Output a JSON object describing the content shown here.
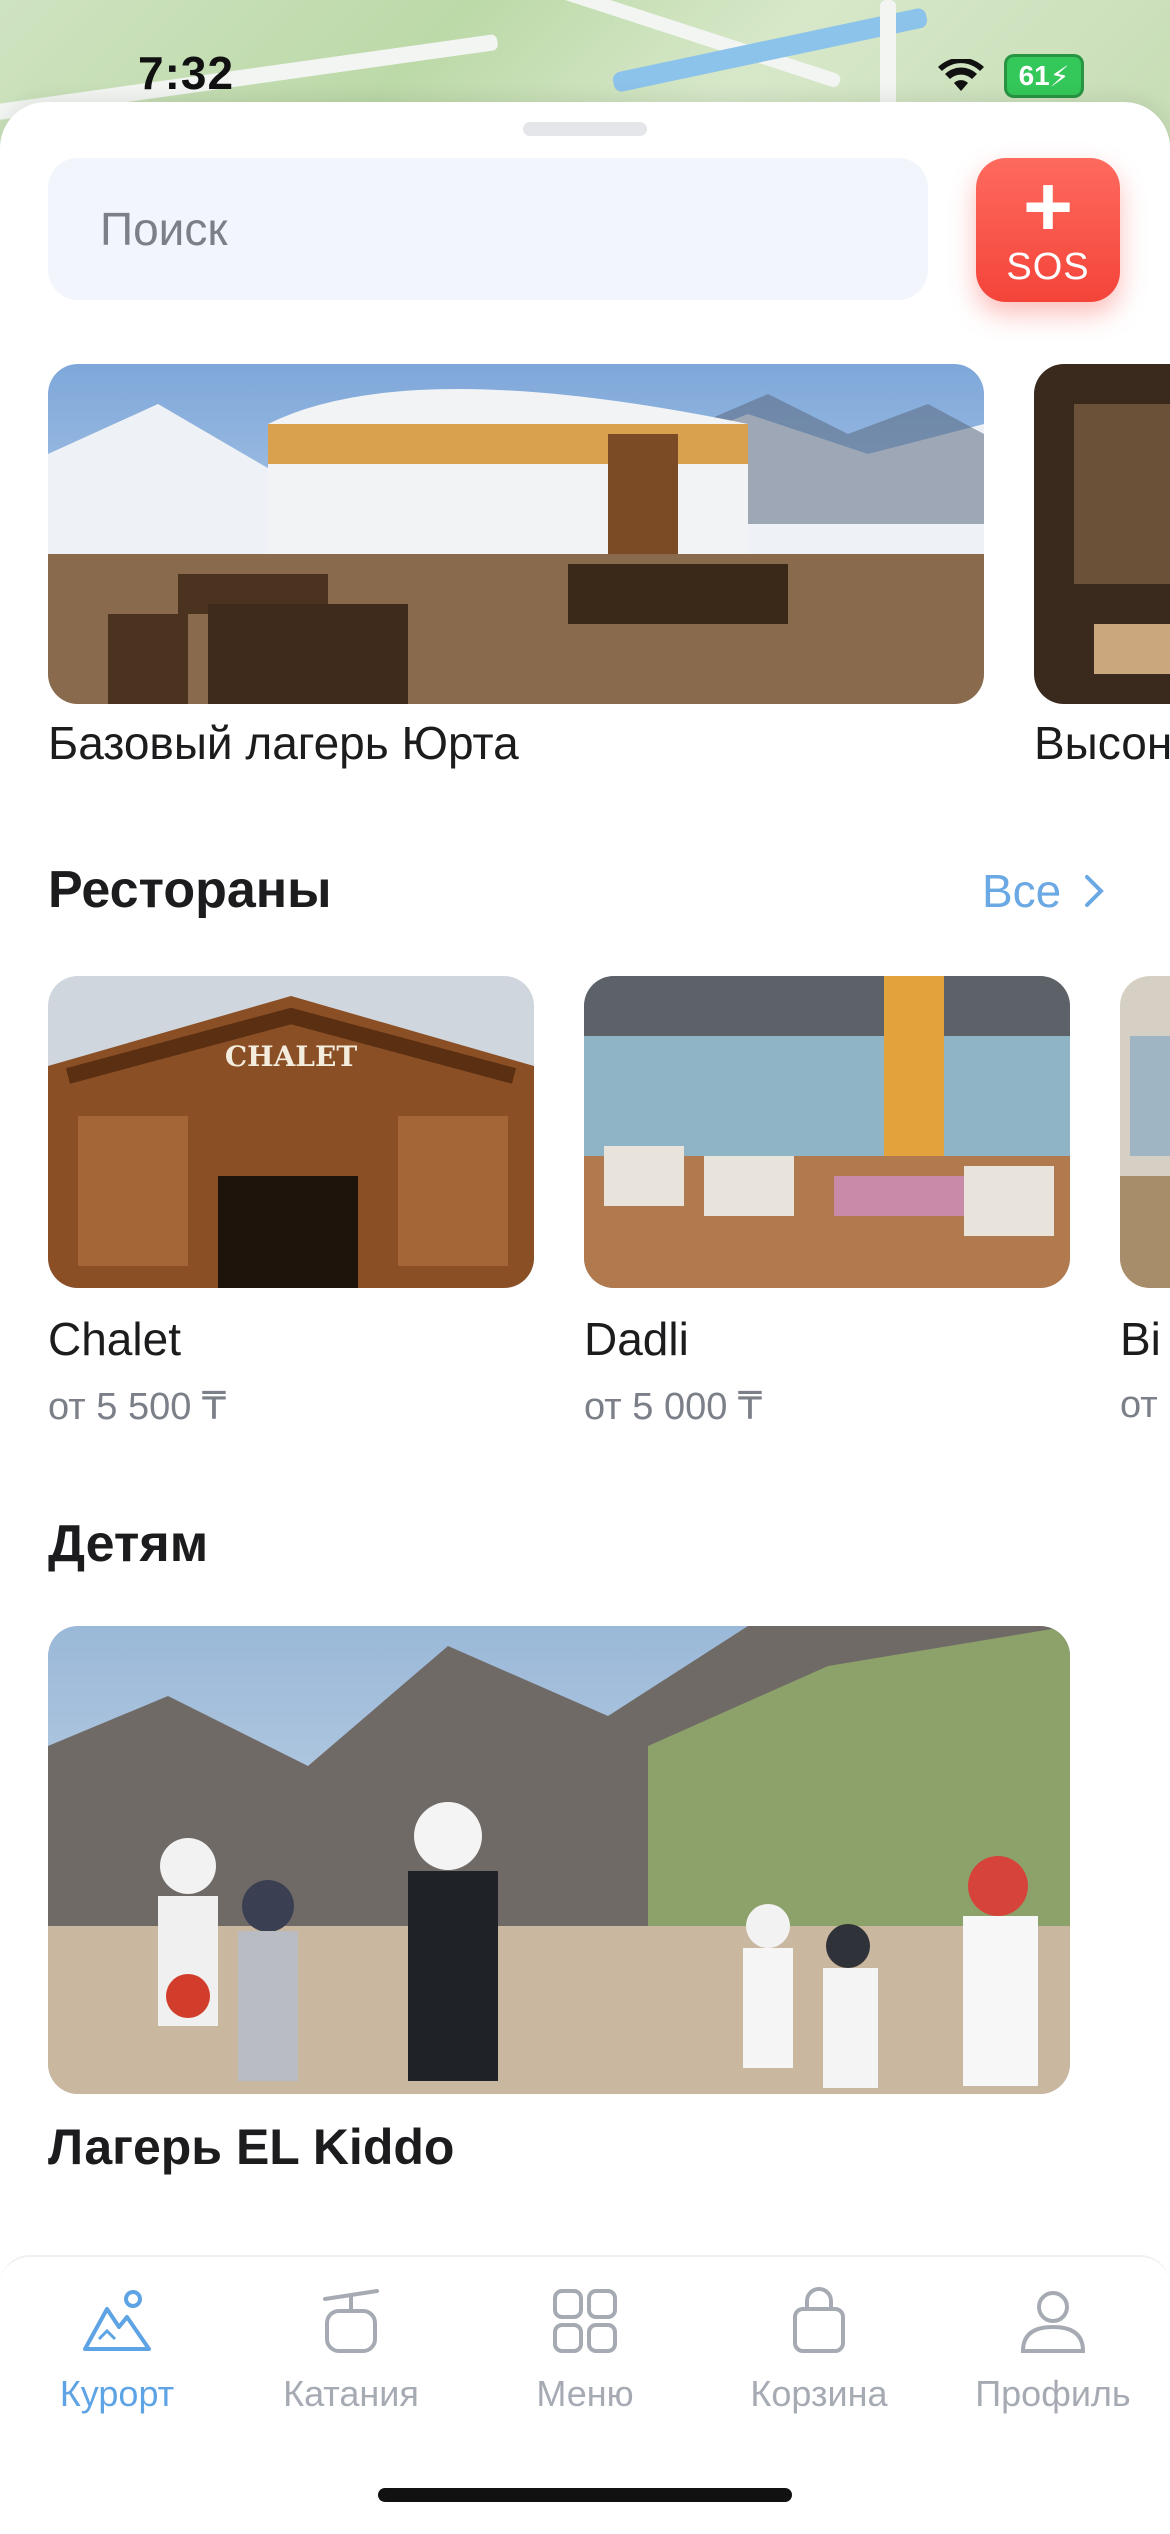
{
  "status_bar": {
    "time": "7:32",
    "battery": "61"
  },
  "search": {
    "placeholder": "Поиск"
  },
  "sos_button": {
    "label": "SOS"
  },
  "featured": {
    "items": [
      {
        "title": "Базовый лагерь Юрта"
      },
      {
        "title": "Высон"
      }
    ]
  },
  "restaurants": {
    "title": "Рестораны",
    "see_all": "Все",
    "items": [
      {
        "name": "Chalet",
        "price": "от 5 500 ₸"
      },
      {
        "name": "Dadli",
        "price": "от 5 000 ₸"
      },
      {
        "name": "Bi",
        "price": "от"
      }
    ]
  },
  "kids": {
    "title": "Детям",
    "items": [
      {
        "title": "Лагерь EL Kiddo"
      }
    ]
  },
  "tabbar": {
    "tabs": [
      {
        "label": "Курорт",
        "active": true
      },
      {
        "label": "Катания",
        "active": false
      },
      {
        "label": "Меню",
        "active": false
      },
      {
        "label": "Корзина",
        "active": false
      },
      {
        "label": "Профиль",
        "active": false
      }
    ]
  },
  "colors": {
    "accent": "#5ea3e4",
    "sos": "#f4443a"
  }
}
